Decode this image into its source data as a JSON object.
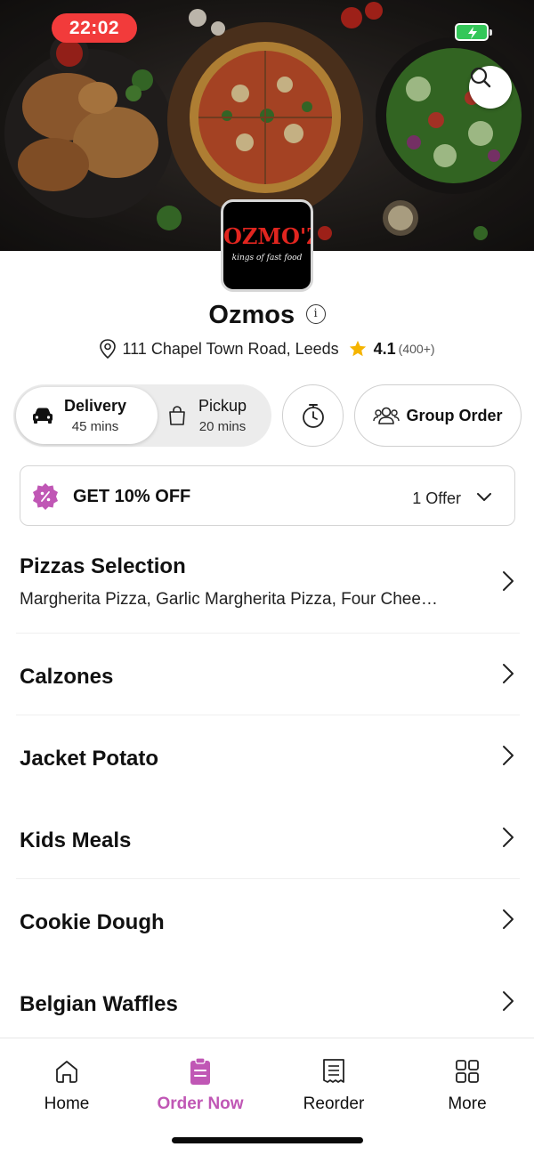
{
  "status_bar": {
    "time": "22:02"
  },
  "restaurant": {
    "name": "Ozmos",
    "logo_text": "OZMO'Z",
    "logo_tagline": "kings of fast food",
    "address": "111 Chapel Town Road, Leeds",
    "rating": "4.1",
    "rating_count": "(400+)"
  },
  "mode_toggle": {
    "delivery": {
      "label": "Delivery",
      "time": "45 mins",
      "selected": true
    },
    "pickup": {
      "label": "Pickup",
      "time": "20 mins",
      "selected": false
    }
  },
  "group_order_label": "Group Order",
  "offer": {
    "title": "GET 10% OFF",
    "count": "1 Offer"
  },
  "categories": [
    {
      "name": "Pizzas Selection",
      "items": "Margherita Pizza, Garlic Margherita Pizza, Four Chee…"
    },
    {
      "name": "Calzones"
    },
    {
      "name": "Jacket Potato"
    },
    {
      "name": "Kids Meals"
    },
    {
      "name": "Cookie Dough"
    },
    {
      "name": "Belgian Waffles"
    }
  ],
  "bottom_nav": [
    {
      "label": "Home",
      "icon": "home-icon"
    },
    {
      "label": "Order Now",
      "icon": "order-icon",
      "active": true
    },
    {
      "label": "Reorder",
      "icon": "receipt-icon"
    },
    {
      "label": "More",
      "icon": "grid-icon"
    }
  ],
  "colors": {
    "accent": "#c057b5",
    "star": "#f5b400",
    "time_pill": "#f23b3b",
    "logo_red": "#e0251f"
  }
}
